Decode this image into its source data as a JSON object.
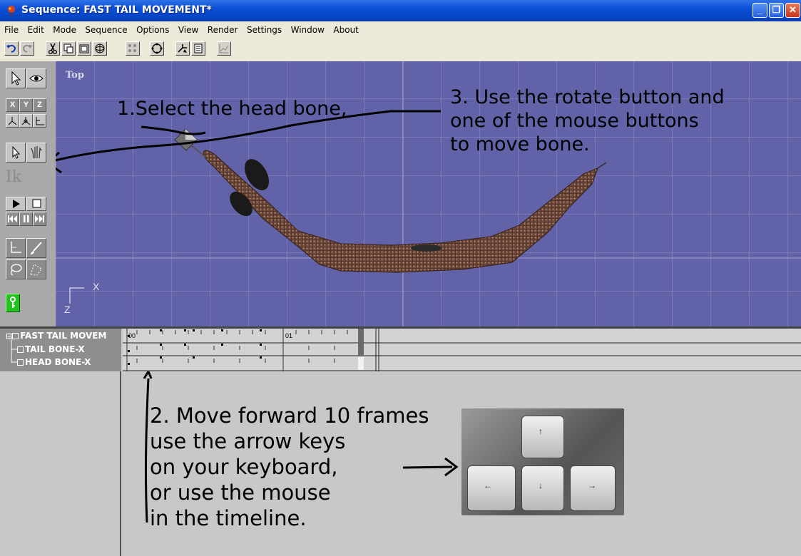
{
  "window": {
    "title": "Sequence: FAST TAIL MOVEMENT*",
    "minimize": "_",
    "restore": "❐",
    "close": "✕"
  },
  "menu": [
    "File",
    "Edit",
    "Mode",
    "Sequence",
    "Options",
    "View",
    "Render",
    "Settings",
    "Window",
    "About"
  ],
  "palette": {
    "axis_x": "X",
    "axis_y": "Y",
    "axis_z": "Z",
    "ik": "Ik"
  },
  "viewport": {
    "view_label": "Top",
    "axis_x_label": "X",
    "axis_z_label": "Z"
  },
  "annotations": {
    "step1": "1.Select the head bone,",
    "step3": "3. Use the rotate button and\none of the mouse buttons\nto move bone.",
    "step2": "2. Move forward 10 frames\nuse the arrow keys\non your keyboard,\nor use the mouse\nin the timeline."
  },
  "tracks": [
    {
      "label": "FAST TAIL MOVEM"
    },
    {
      "label": "TAIL BONE-X"
    },
    {
      "label": "HEAD BONE-X"
    }
  ],
  "timeline": {
    "mark_start": "00",
    "mark_second": "01"
  },
  "keyboard": {
    "up": "↑",
    "left": "←",
    "down": "↓",
    "right": "→"
  },
  "colors": {
    "viewport_bg": "#6262a8",
    "titlebar": "#0a4fd6",
    "key_active": "#22c21f"
  }
}
